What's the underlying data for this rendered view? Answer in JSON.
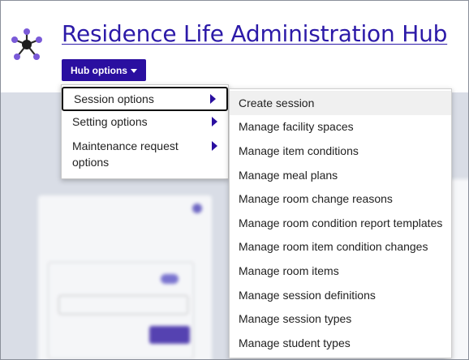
{
  "header": {
    "title": "Residence Life Administration Hub",
    "hub_button_label": "Hub options",
    "logo_icon": "network-hub-icon",
    "brand_color": "#2a0fa0"
  },
  "primary_menu": {
    "items": [
      {
        "label": "Session options",
        "icon": "chevron-right-icon",
        "active": true
      },
      {
        "label": "Setting options",
        "icon": "chevron-right-icon",
        "active": false
      },
      {
        "label": "Maintenance request options",
        "icon": "chevron-right-icon",
        "active": false
      }
    ]
  },
  "submenu": {
    "items": [
      {
        "label": "Create session",
        "hovered": true
      },
      {
        "label": "Manage facility spaces"
      },
      {
        "label": "Manage item conditions"
      },
      {
        "label": "Manage meal plans"
      },
      {
        "label": "Manage room change reasons"
      },
      {
        "label": "Manage room condition report templates"
      },
      {
        "label": "Manage room item condition changes"
      },
      {
        "label": "Manage room items"
      },
      {
        "label": "Manage session definitions"
      },
      {
        "label": "Manage session types"
      },
      {
        "label": "Manage student types"
      }
    ]
  }
}
